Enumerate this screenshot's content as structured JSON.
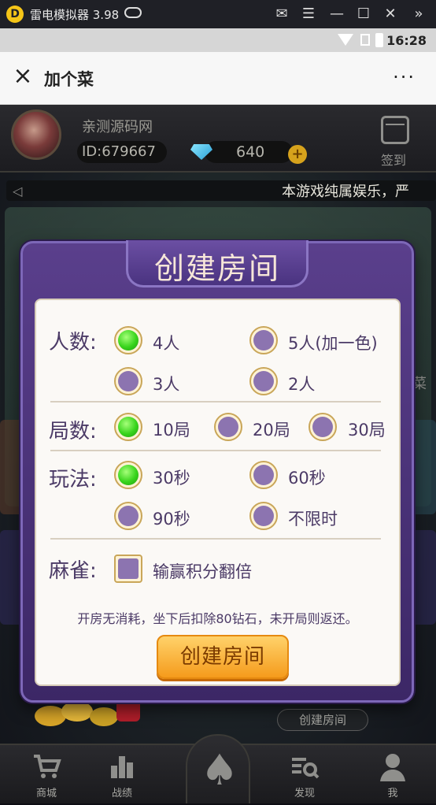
{
  "emulator": {
    "logo": "D",
    "title": "雷电模拟器 3.98",
    "icons": [
      "gamepad-icon",
      "mail-icon",
      "menu-icon",
      "minimize-icon",
      "maximize-icon",
      "close-icon",
      "collapse-icon"
    ]
  },
  "status_bar": {
    "time": "16:28",
    "icons": [
      "wifi-icon",
      "sim-icon",
      "battery-icon"
    ]
  },
  "header": {
    "close_icon": "×",
    "title": "加个菜",
    "more_icon": "···"
  },
  "profile": {
    "name": "亲测源码网",
    "id": "ID:679667",
    "diamonds": "640",
    "plus": "+",
    "sign_in_label": "签到"
  },
  "notice": {
    "speaker": "◁",
    "text": "本游戏纯属娱乐，严"
  },
  "dialog": {
    "title": "创建房间",
    "players": {
      "label": "人数:",
      "options": [
        {
          "label": "4人",
          "selected": true
        },
        {
          "label": "5人(加一色)",
          "selected": false
        },
        {
          "label": "3人",
          "selected": false
        },
        {
          "label": "2人",
          "selected": false
        }
      ]
    },
    "rounds": {
      "label": "局数:",
      "options": [
        {
          "label": "10局",
          "selected": true
        },
        {
          "label": "20局",
          "selected": false
        },
        {
          "label": "30局",
          "selected": false
        }
      ]
    },
    "mode": {
      "label": "玩法:",
      "options": [
        {
          "label": "30秒",
          "selected": true
        },
        {
          "label": "60秒",
          "selected": false
        },
        {
          "label": "90秒",
          "selected": false
        },
        {
          "label": "不限时",
          "selected": false
        }
      ]
    },
    "mahjong": {
      "label": "麻雀:",
      "checkbox_label": "输赢积分翻倍",
      "checked": false
    },
    "note": "开房无消耗，坐下后扣除80钻石，未开局则返还。",
    "create_button": "创建房间"
  },
  "background": {
    "create_room_button": "创建房间",
    "side_char": "菜"
  },
  "bottom_nav": {
    "items": [
      {
        "label": "商城",
        "icon": "cart-icon"
      },
      {
        "label": "战绩",
        "icon": "bar-chart-icon"
      },
      {
        "label": "",
        "icon": "spade-icon"
      },
      {
        "label": "发现",
        "icon": "search-list-icon"
      },
      {
        "label": "我",
        "icon": "person-icon"
      }
    ],
    "spade_glyph": "♠"
  }
}
